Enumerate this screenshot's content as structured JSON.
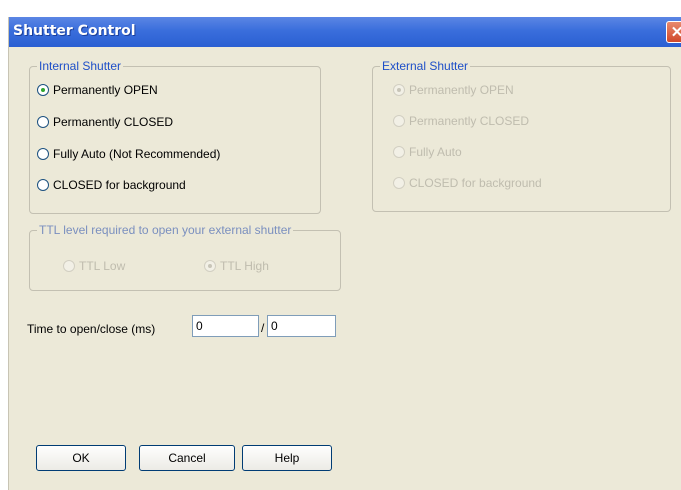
{
  "window": {
    "title": "Shutter Control",
    "close_glyph": "✕"
  },
  "internal_shutter": {
    "legend": "Internal Shutter",
    "options": [
      {
        "label": "Permanently OPEN",
        "selected": true
      },
      {
        "label": "Permanently CLOSED",
        "selected": false
      },
      {
        "label": "Fully Auto (Not Recommended)",
        "selected": false
      },
      {
        "label": "CLOSED for background",
        "selected": false
      }
    ]
  },
  "external_shutter": {
    "legend": "External Shutter",
    "enabled": false,
    "options": [
      {
        "label": "Permanently OPEN",
        "selected": true
      },
      {
        "label": "Permanently CLOSED",
        "selected": false
      },
      {
        "label": "Fully Auto",
        "selected": false
      },
      {
        "label": "CLOSED for background",
        "selected": false
      }
    ]
  },
  "ttl": {
    "legend": "TTL level required to open your external shutter",
    "enabled": false,
    "options": [
      {
        "label": "TTL Low",
        "selected": false
      },
      {
        "label": "TTL High",
        "selected": true
      }
    ]
  },
  "timing": {
    "label": "Time to open/close (ms)",
    "open_value": "0",
    "separator": "/",
    "close_value": "0"
  },
  "buttons": {
    "ok": "OK",
    "cancel": "Cancel",
    "help": "Help"
  }
}
